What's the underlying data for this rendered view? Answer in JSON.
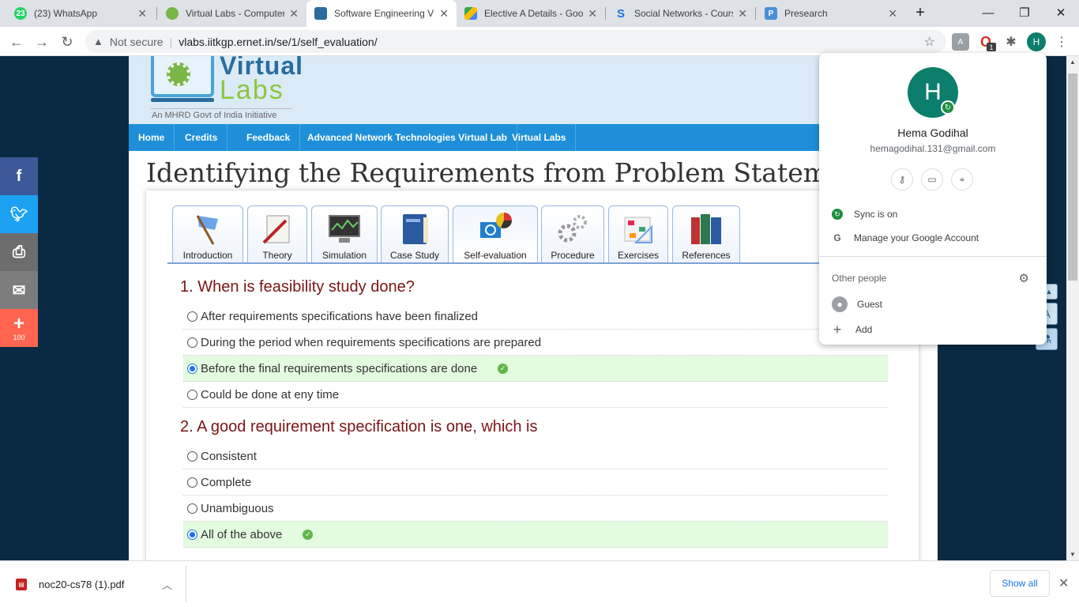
{
  "browser": {
    "tabs": [
      {
        "title": "(23) WhatsApp",
        "favicon_text": "23",
        "favicon_color": "#25d366"
      },
      {
        "title": "Virtual Labs - Computer",
        "favicon_text": "",
        "favicon_color": "#7ab648"
      },
      {
        "title": "Software Engineering V",
        "favicon_text": "",
        "favicon_color": "#2b6c9e"
      },
      {
        "title": "Elective A Details - Goo",
        "favicon_text": "",
        "favicon_color": "#fbbc04"
      },
      {
        "title": "Social Networks - Cours",
        "favicon_text": "S",
        "favicon_color": "#1a73e8"
      },
      {
        "title": "Presearch",
        "favicon_text": "P",
        "favicon_color": "#4a90d9"
      }
    ],
    "address": {
      "security_label": "Not secure",
      "url": "vlabs.iitkgp.ernet.in/se/1/self_evaluation/"
    },
    "extension_badge": "1",
    "profile_initial": "H"
  },
  "site": {
    "logo_virtual": "Virtual",
    "logo_labs": "Labs",
    "logo_sub": "An MHRD Govt of India Initiative",
    "nav": [
      "Home",
      "Credits",
      "Feedback",
      "Advanced Network Technologies Virtual Lab",
      "Virtual Labs"
    ],
    "title": "Identifying the Requirements from Problem Statements",
    "tabs": [
      "Introduction",
      "Theory",
      "Simulation",
      "Case Study",
      "Self-evaluation",
      "Procedure",
      "Exercises",
      "References"
    ]
  },
  "quiz": {
    "questions": [
      {
        "text": "1. When is feasibility study done?",
        "options": [
          {
            "text": "After requirements specifications have been finalized",
            "selected": false,
            "correct": false
          },
          {
            "text": "During the period when requirements specifications are prepared",
            "selected": false,
            "correct": false
          },
          {
            "text": "Before the final requirements specifications are done",
            "selected": true,
            "correct": true
          },
          {
            "text": "Could be done at eny time",
            "selected": false,
            "correct": false
          }
        ]
      },
      {
        "text": "2. A good requirement specification is one, which is",
        "options": [
          {
            "text": "Consistent",
            "selected": false,
            "correct": false
          },
          {
            "text": "Complete",
            "selected": false,
            "correct": false
          },
          {
            "text": "Unambiguous",
            "selected": false,
            "correct": false
          },
          {
            "text": "All of the above",
            "selected": true,
            "correct": true
          }
        ]
      }
    ]
  },
  "social": {
    "share_count": "100",
    "items": [
      {
        "icon": "facebook-icon",
        "glyph": "f",
        "color": "#3b5998"
      },
      {
        "icon": "twitter-icon",
        "glyph": "t",
        "color": "#1da1f2"
      },
      {
        "icon": "print-icon",
        "glyph": "⎙",
        "color": "#6d6d6d"
      },
      {
        "icon": "email-icon",
        "glyph": "✉",
        "color": "#7d7d7d"
      },
      {
        "icon": "share-plus-icon",
        "glyph": "+",
        "color": "#ff6550"
      }
    ]
  },
  "profile_menu": {
    "name": "Hema Godihal",
    "email": "hemagodihal.131@gmail.com",
    "sync": "Sync is on",
    "manage": "Manage your Google Account",
    "other_people": "Other people",
    "guest": "Guest",
    "add": "Add"
  },
  "downloads": {
    "file": "noc20-cs78 (1).pdf",
    "show_all": "Show all"
  }
}
